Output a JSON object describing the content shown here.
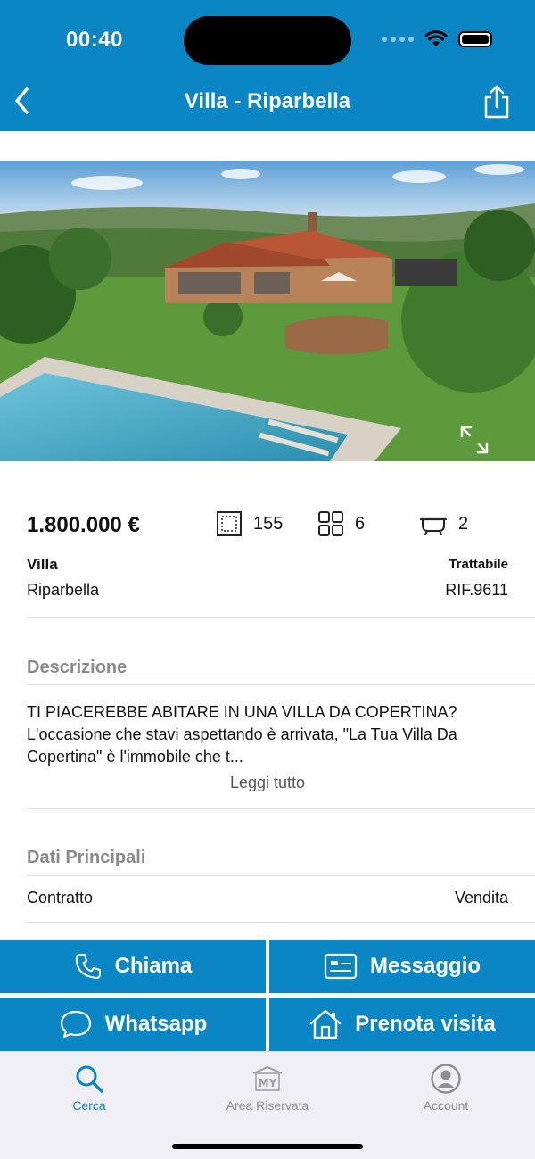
{
  "status_bar": {
    "time": "00:40"
  },
  "nav": {
    "title": "Villa - Riparbella"
  },
  "listing": {
    "price": "1.800.000 €",
    "area": "155",
    "rooms": "6",
    "bathrooms": "2",
    "type": "Villa",
    "location": "Riparbella",
    "negotiable": "Trattabile",
    "reference": "RIF.9611"
  },
  "description": {
    "title": "Descrizione",
    "text": "TI PIACEREBBE ABITARE IN UNA VILLA DA COPERTINA? L'occasione che stavi aspettando è arrivata, \"La Tua Villa Da Copertina\" è l'immobile che t...",
    "read_more": "Leggi tutto"
  },
  "main_data": {
    "title": "Dati Principali",
    "rows": [
      {
        "label": "Contratto",
        "value": "Vendita"
      }
    ]
  },
  "actions": {
    "call": "Chiama",
    "message": "Messaggio",
    "whatsapp": "Whatsapp",
    "book_visit": "Prenota visita"
  },
  "tabs": [
    {
      "label": "Cerca",
      "active": true
    },
    {
      "label": "Area Riservata",
      "active": false
    },
    {
      "label": "Account",
      "active": false
    }
  ],
  "colors": {
    "brand": "#0a86c5",
    "tab_inactive": "#8e8e93"
  },
  "icons": [
    "back-chevron-icon",
    "share-icon",
    "expand-icon",
    "area-icon",
    "rooms-icon",
    "bathtub-icon",
    "phone-icon",
    "message-card-icon",
    "chat-bubble-icon",
    "house-icon",
    "search-icon",
    "my-house-icon",
    "account-icon"
  ]
}
